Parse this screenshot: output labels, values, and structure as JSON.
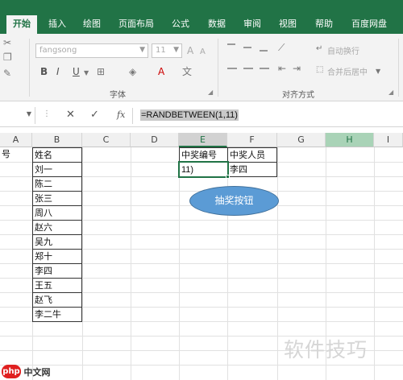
{
  "ribbon": {
    "tabs": [
      "开始",
      "插入",
      "绘图",
      "页面布局",
      "公式",
      "数据",
      "审阅",
      "视图",
      "帮助",
      "百度网盘"
    ],
    "active_tab": "开始",
    "font_name": "fangsong",
    "font_size": "11",
    "bold": "B",
    "italic": "I",
    "underline": "U",
    "font_group_label": "字体",
    "alignment_group_label": "对齐方式",
    "wrap_text": "自动换行",
    "merge_center": "合并后居中"
  },
  "formula_bar": {
    "name_box": "",
    "cancel": "✕",
    "enter": "✓",
    "fx": "fx",
    "formula": "=RANDBETWEEN(1,11)"
  },
  "sheet": {
    "columns": [
      "A",
      "B",
      "C",
      "D",
      "E",
      "F",
      "G",
      "H"
    ],
    "selected_column": "E",
    "highlighted_column": "H",
    "a1_partial": "号",
    "b_header": "姓名",
    "names": [
      "刘一",
      "陈二",
      "张三",
      "周八",
      "赵六",
      "吴九",
      "郑十",
      "李四",
      "王五",
      "赵飞",
      "李二牛"
    ],
    "e_header": "中奖编号",
    "f_header": "中奖人员",
    "e_value": "11)",
    "f_value": "李四"
  },
  "draw_button": {
    "label": "抽奖按钮"
  },
  "watermark": {
    "text": "软件技巧"
  },
  "logo": {
    "badge": "php",
    "text": "中文网"
  },
  "colors": {
    "accent": "#217346",
    "button": "#5b9bd5"
  }
}
